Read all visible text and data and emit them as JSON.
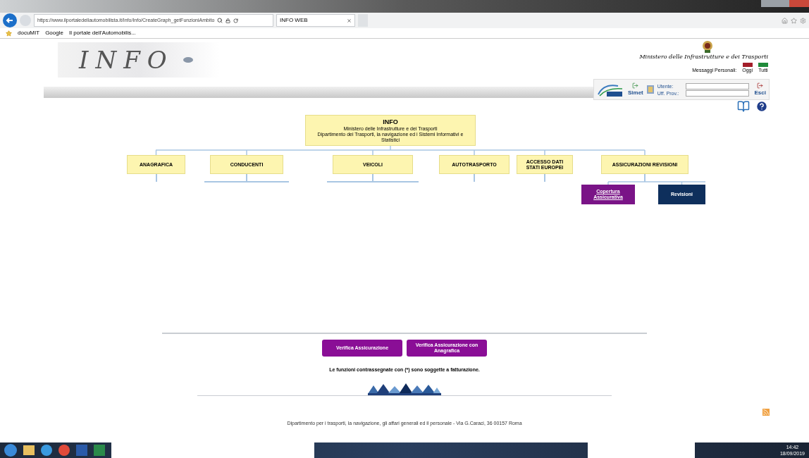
{
  "browser": {
    "url": "https://www.ilportaledellautomobilista.it/Info/Info/CreateGraph_getFunzioniAmbito",
    "tab_title": "INFO WEB",
    "favorites": [
      "docuMIT",
      "Google",
      "Il portale dell'Automobilis..."
    ]
  },
  "header": {
    "logo": "INFO",
    "ministry": "Ministero delle Infrastrutture e dei Trasporti",
    "messages_label": "Messaggi Personali:",
    "message_links": [
      "Oggi",
      "Tutti"
    ],
    "login": {
      "app_label": "Simet",
      "fields": [
        {
          "label": "Utente:"
        },
        {
          "label": "Uff. Prov.:"
        }
      ],
      "exit": "Esci"
    }
  },
  "org_chart": {
    "root": {
      "title": "INFO",
      "subtitle": "Ministero delle Infrastrutture e dei Trasporti",
      "note": "Dipartimento dei Trasporti, la navigazione ed i Sistemi Informativi e Statistici"
    },
    "children": [
      {
        "label": "ANAGRAFICA",
        "hidden_branch": false
      },
      {
        "label": "CONDUCENTI",
        "hidden_branch": true
      },
      {
        "label": "VEICOLI",
        "hidden_branch": true
      },
      {
        "label": "AUTOTRASPORTO",
        "hidden_branch": false
      },
      {
        "label": "ACCESSO DATI STATI EUROPEI",
        "hidden_branch": false
      },
      {
        "label": "ASSICURAZIONI REVISIONI",
        "hidden_branch": false,
        "children": [
          {
            "label": "Copertura Assicurativa",
            "color": "#7a1487",
            "underlined": true
          },
          {
            "label": "Revisioni",
            "color": "#0e2f5c",
            "underlined": false
          }
        ]
      }
    ]
  },
  "actions": [
    "Verifica Assicurazione",
    "Verifica Assicurazione con Anagrafica"
  ],
  "notice": "Le funzioni contrassegnate con (*) sono soggette a fatturazione.",
  "footer": "Dipartimento per i trasporti, la navigazione, gli affari generali ed il personale - Via G.Caraci, 36 00157 Roma",
  "taskbar": {
    "time": "14:42",
    "date": "18/09/2019"
  }
}
